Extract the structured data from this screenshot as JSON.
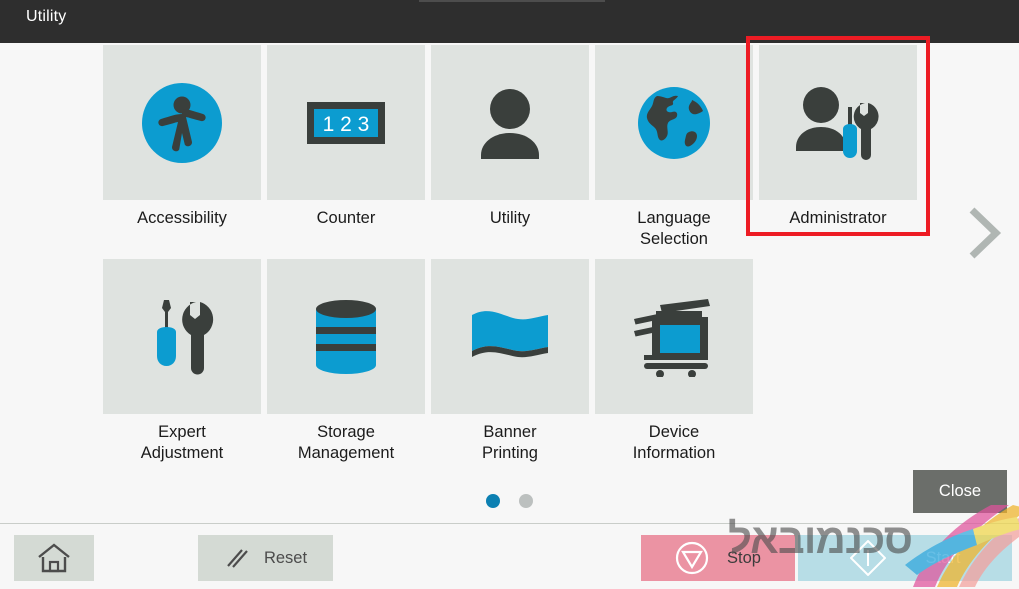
{
  "header": {
    "title": "Utility"
  },
  "tiles": [
    {
      "id": "accessibility",
      "label": "Accessibility",
      "icon": "accessibility-icon",
      "selected": false
    },
    {
      "id": "counter",
      "label": "Counter",
      "icon": "counter-123-icon",
      "selected": false
    },
    {
      "id": "utility",
      "label": "Utility",
      "icon": "user-icon",
      "selected": false
    },
    {
      "id": "language-selection",
      "label": "Language\nSelection",
      "icon": "globe-icon",
      "selected": false
    },
    {
      "id": "administrator",
      "label": "Administrator",
      "icon": "administrator-tools-icon",
      "selected": true
    },
    {
      "id": "expert-adjustment",
      "label": "Expert\nAdjustment",
      "icon": "screwdriver-wrench-icon",
      "selected": false
    },
    {
      "id": "storage-management",
      "label": "Storage\nManagement",
      "icon": "database-icon",
      "selected": false
    },
    {
      "id": "banner-printing",
      "label": "Banner\nPrinting",
      "icon": "banner-flag-icon",
      "selected": false
    },
    {
      "id": "device-information",
      "label": "Device\nInformation",
      "icon": "printer-icon",
      "selected": false
    }
  ],
  "counter_icon": {
    "digits": "1 2 3"
  },
  "navigation": {
    "next_page_icon": "chevron-right-icon",
    "page_dots": [
      {
        "active": true
      },
      {
        "active": false
      }
    ]
  },
  "close_button": {
    "label": "Close"
  },
  "bottom_bar": {
    "home": {
      "icon": "home-icon",
      "label": ""
    },
    "reset": {
      "icon": "reset-slashes-icon",
      "label": "Reset"
    },
    "stop": {
      "icon": "stop-triangle-icon",
      "label": "Stop"
    },
    "start": {
      "icon": "start-diamond-icon",
      "label": "Start"
    }
  },
  "watermark": {
    "text": "סכנמובאל",
    "logo": "colored-swoosh-logo"
  },
  "colors": {
    "header_bg": "#2e2e2e",
    "page_bg": "#f7f7f7",
    "tile_bg": "#dfe3e0",
    "accent_blue": "#0c9cd0",
    "icon_dark": "#3a3f3c",
    "selection_red": "#ed1c24",
    "stop_pink": "#eb93a3",
    "start_blue": "#b7dde6",
    "close_gray": "#6b6e6a",
    "dot_active": "#0c80b2",
    "dot_inactive": "#bcc0bf"
  }
}
